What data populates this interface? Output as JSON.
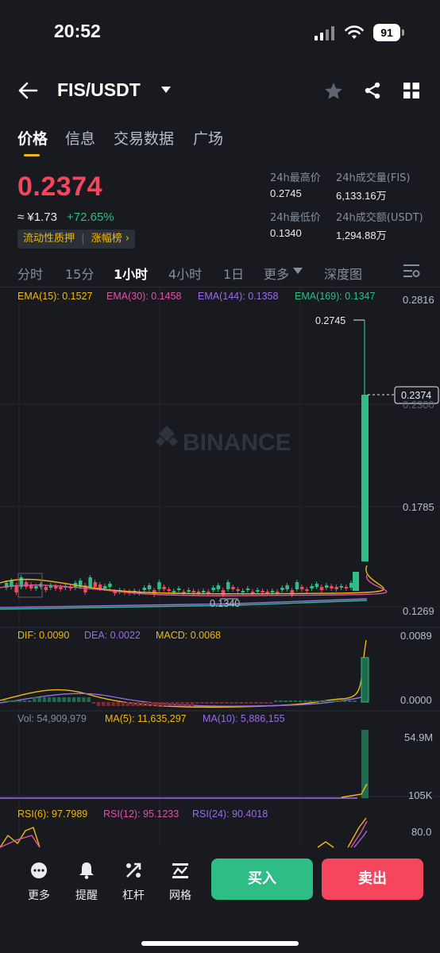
{
  "status": {
    "time": "20:52",
    "battery": "91"
  },
  "header": {
    "pair": "FIS/USDT"
  },
  "tabs": [
    "价格",
    "信息",
    "交易数据",
    "广场"
  ],
  "price": {
    "last": "0.2374",
    "cny": "≈ ¥1.73",
    "change": "+72.65%",
    "tag_label_1": "流动性质押",
    "tag_label_2": "涨幅榜",
    "high_label": "24h最高价",
    "high_value": "0.2745",
    "low_label": "24h最低价",
    "low_value": "0.1340",
    "vol_label": "24h成交量(FIS)",
    "vol_value": "6,133.16万",
    "amt_label": "24h成交额(USDT)",
    "amt_value": "1,294.88万"
  },
  "intervals": [
    "分时",
    "15分",
    "1小时",
    "4小时",
    "1日",
    "更多",
    "深度图"
  ],
  "ema": {
    "e15": "EMA(15): 0.1527",
    "e30": "EMA(30): 0.1458",
    "e144": "EMA(144): 0.1358",
    "e169": "EMA(169): 0.1347"
  },
  "chart_axis": {
    "top": "0.2816",
    "high_marker": "0.2745",
    "mid1": "0.2300",
    "current": "0.2374",
    "mid2": "0.1785",
    "bottom": "0.1269",
    "low_marker": "0.1340"
  },
  "watermark": "BINANCE",
  "macd": {
    "dif": "DIF: 0.0090",
    "dea": "DEA: 0.0022",
    "macd": "MACD: 0.0068",
    "axis_top": "0.0089",
    "axis_zero": "0.0000"
  },
  "volume": {
    "vol": "Vol: 54,909,979",
    "ma5": "MA(5): 11,635,297",
    "ma10": "MA(10): 5,886,155",
    "axis_top": "54.9M",
    "axis_bottom": "105K"
  },
  "rsi": {
    "r6": "RSI(6): 97.7989",
    "r12": "RSI(12): 95.1233",
    "r24": "RSI(24): 90.4018",
    "axis_top": "80.0"
  },
  "bottom_nav": {
    "more": "更多",
    "alert": "提醒",
    "margin": "杠杆",
    "grid": "网格",
    "buy": "买入",
    "sell": "卖出"
  },
  "colors": {
    "up": "#2ebd85",
    "down": "#f6465d",
    "accent": "#f0b90b",
    "bg": "#181a20"
  }
}
